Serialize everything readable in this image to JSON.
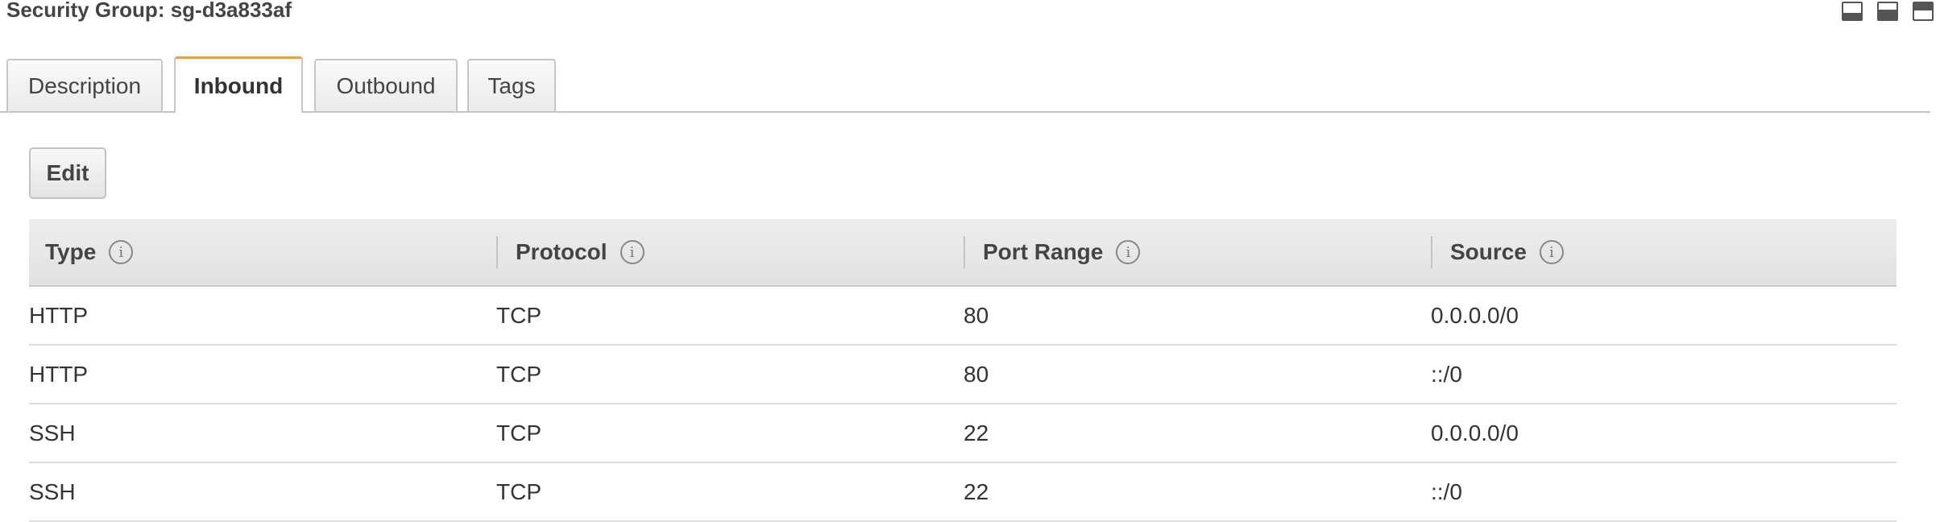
{
  "panel": {
    "title": "Security Group: sg-d3a833af"
  },
  "layout_buttons": [
    {
      "icon": "panel-bottom-icon"
    },
    {
      "icon": "panel-split-icon"
    },
    {
      "icon": "panel-top-icon"
    }
  ],
  "tabs": [
    {
      "label": "Description",
      "active": false
    },
    {
      "label": "Inbound",
      "active": true
    },
    {
      "label": "Outbound",
      "active": false
    },
    {
      "label": "Tags",
      "active": false
    }
  ],
  "toolbar": {
    "edit_label": "Edit"
  },
  "table": {
    "info_glyph": "i",
    "columns": [
      "Type",
      "Protocol",
      "Port Range",
      "Source"
    ],
    "rows": [
      [
        "HTTP",
        "TCP",
        "80",
        "0.0.0.0/0"
      ],
      [
        "HTTP",
        "TCP",
        "80",
        "::/0"
      ],
      [
        "SSH",
        "TCP",
        "22",
        "0.0.0.0/0"
      ],
      [
        "SSH",
        "TCP",
        "22",
        "::/0"
      ]
    ]
  },
  "colors": {
    "active_tab_accent": "#f0a030",
    "header_bg": "#e6e6e6",
    "text": "#333333"
  }
}
